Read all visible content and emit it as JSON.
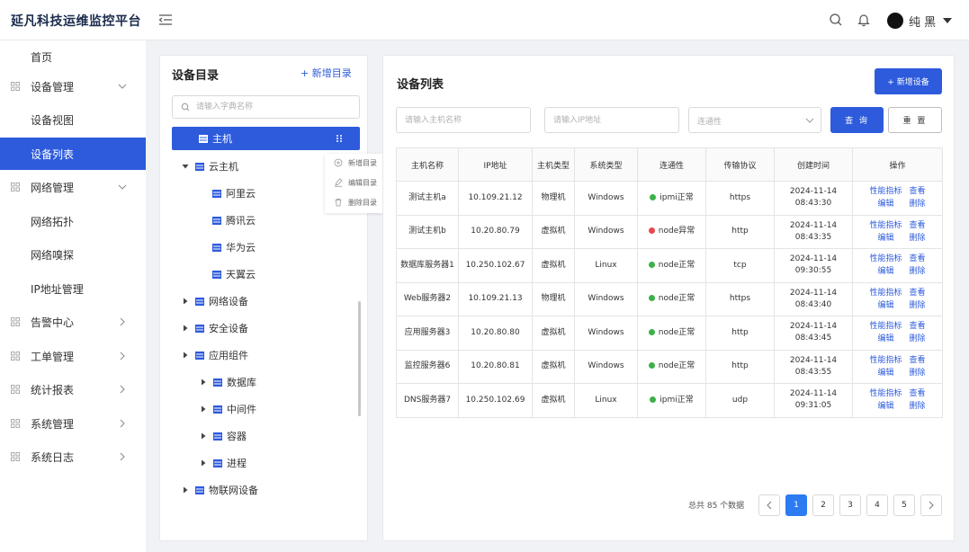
{
  "app": {
    "title": "延凡科技运维监控平台"
  },
  "header": {
    "user_name": "纯 黑"
  },
  "sidebar": {
    "items": [
      {
        "label": "首页"
      },
      {
        "label": "设备管理"
      },
      {
        "label": "设备视图"
      },
      {
        "label": "设备列表"
      },
      {
        "label": "网络管理"
      },
      {
        "label": "网络拓扑"
      },
      {
        "label": "网络嗅探"
      },
      {
        "label": "IP地址管理"
      },
      {
        "label": "告警中心"
      },
      {
        "label": "工单管理"
      },
      {
        "label": "统计报表"
      },
      {
        "label": "系统管理"
      },
      {
        "label": "系统日志"
      }
    ]
  },
  "catalog": {
    "title": "设备目录",
    "add_label": "+ 新增目录",
    "search_placeholder": "请输入字典名称",
    "tree": [
      {
        "label": "主机"
      },
      {
        "label": "云主机"
      },
      {
        "label": "阿里云"
      },
      {
        "label": "腾讯云"
      },
      {
        "label": "华为云"
      },
      {
        "label": "天翼云"
      },
      {
        "label": "网络设备"
      },
      {
        "label": "安全设备"
      },
      {
        "label": "应用组件"
      },
      {
        "label": "数据库"
      },
      {
        "label": "中间件"
      },
      {
        "label": "容器"
      },
      {
        "label": "进程"
      },
      {
        "label": "物联网设备"
      }
    ],
    "context_menu": [
      {
        "label": "新增目录"
      },
      {
        "label": "编辑目录"
      },
      {
        "label": "删除目录"
      }
    ]
  },
  "device_list": {
    "title": "设备列表",
    "add_button": "+ 新增设备",
    "filters": {
      "host_placeholder": "请输入主机名称",
      "ip_placeholder": "请输入IP地址",
      "connectivity_placeholder": "连通性"
    },
    "query_button": "查 询",
    "reset_button": "重 置",
    "columns": [
      "主机名称",
      "IP地址",
      "主机类型",
      "系统类型",
      "连通性",
      "传输协议",
      "创建时间",
      "操作"
    ],
    "ops": [
      "性能指标",
      "查看",
      "编辑",
      "删除"
    ],
    "rows": [
      {
        "name": "测试主机a",
        "ip": "10.109.21.12",
        "host_type": "物理机",
        "os": "Windows",
        "status": "ipmi正常",
        "status_color": "#3db04a",
        "protocol": "https",
        "date": "2024-11-14",
        "time": "08:43:30"
      },
      {
        "name": "测试主机b",
        "ip": "10.20.80.79",
        "host_type": "虚拟机",
        "os": "Windows",
        "status": "node异常",
        "status_color": "#e5484d",
        "protocol": "http",
        "date": "2024-11-14",
        "time": "08:43:35"
      },
      {
        "name": "数据库服务器1",
        "ip": "10.250.102.67",
        "host_type": "虚拟机",
        "os": "Linux",
        "status": "node正常",
        "status_color": "#3db04a",
        "protocol": "tcp",
        "date": "2024-11-14",
        "time": "09:30:55"
      },
      {
        "name": "Web服务器2",
        "ip": "10.109.21.13",
        "host_type": "物理机",
        "os": "Windows",
        "status": "node正常",
        "status_color": "#3db04a",
        "protocol": "https",
        "date": "2024-11-14",
        "time": "08:43:40"
      },
      {
        "name": "应用服务器3",
        "ip": "10.20.80.80",
        "host_type": "虚拟机",
        "os": "Windows",
        "status": "node正常",
        "status_color": "#3db04a",
        "protocol": "http",
        "date": "2024-11-14",
        "time": "08:43:45"
      },
      {
        "name": "监控服务器6",
        "ip": "10.20.80.81",
        "host_type": "虚拟机",
        "os": "Windows",
        "status": "node正常",
        "status_color": "#3db04a",
        "protocol": "http",
        "date": "2024-11-14",
        "time": "08:43:55"
      },
      {
        "name": "DNS服务器7",
        "ip": "10.250.102.69",
        "host_type": "虚拟机",
        "os": "Linux",
        "status": "ipmi正常",
        "status_color": "#3db04a",
        "protocol": "udp",
        "date": "2024-11-14",
        "time": "09:31:05"
      }
    ],
    "pagination": {
      "total_text": "总共 85 个数据",
      "pages": [
        "1",
        "2",
        "3",
        "4",
        "5"
      ],
      "current": "1"
    }
  },
  "colors": {
    "accent": "#2d5bdc",
    "ok": "#3db04a",
    "error": "#e5484d"
  }
}
